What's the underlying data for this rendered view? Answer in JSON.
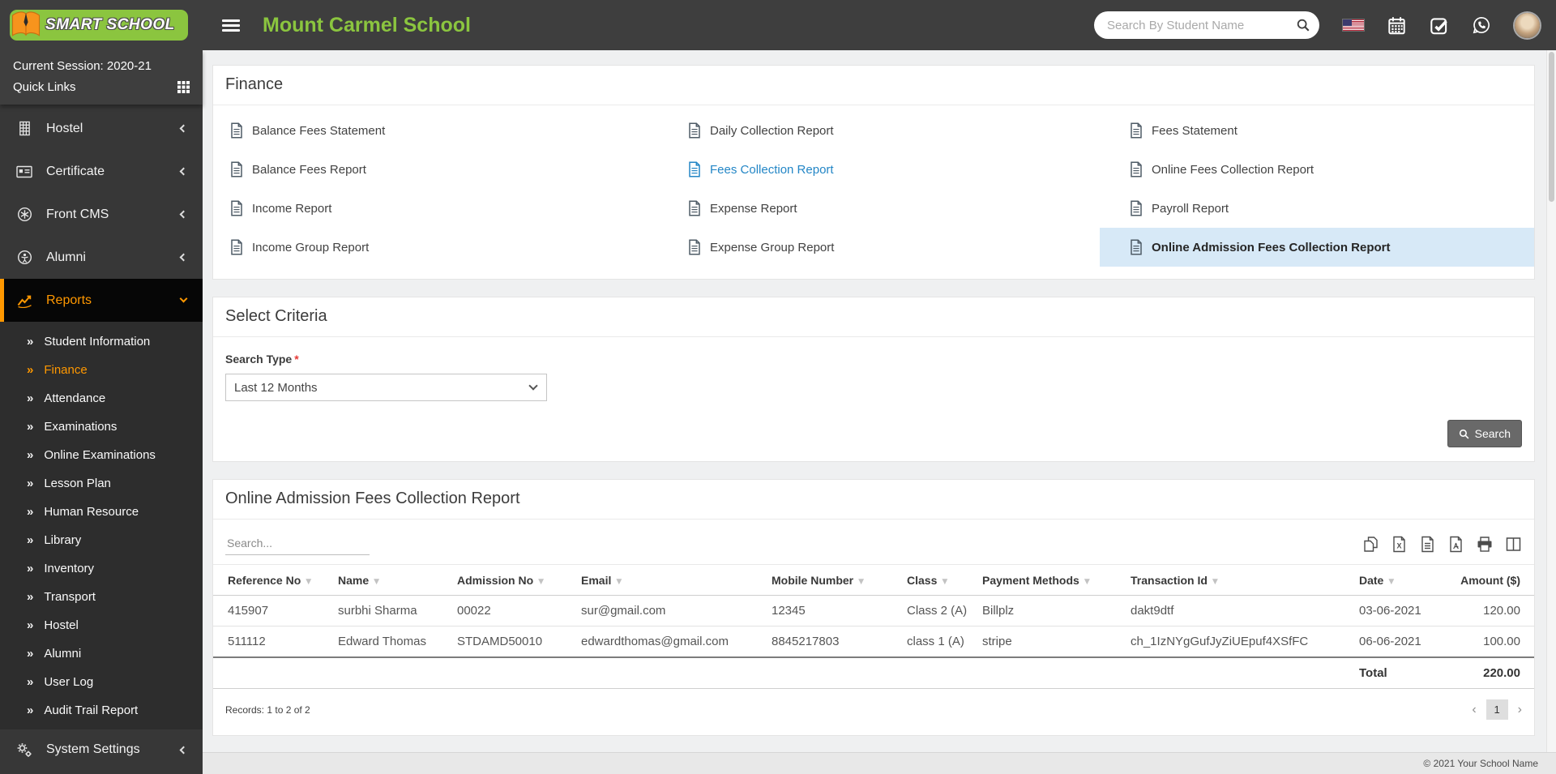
{
  "header": {
    "logo_text": "SMART SCHOOL",
    "school_name": "Mount Carmel School",
    "search_placeholder": "Search By Student Name"
  },
  "sidebar": {
    "session_label": "Current Session: 2020-21",
    "quick_links_label": "Quick Links",
    "items": [
      {
        "label": "Hostel"
      },
      {
        "label": "Certificate"
      },
      {
        "label": "Front CMS"
      },
      {
        "label": "Alumni"
      },
      {
        "label": "Reports"
      }
    ],
    "submenu": [
      "Student Information",
      "Finance",
      "Attendance",
      "Examinations",
      "Online Examinations",
      "Lesson Plan",
      "Human Resource",
      "Library",
      "Inventory",
      "Transport",
      "Hostel",
      "Alumni",
      "User Log",
      "Audit Trail Report"
    ],
    "system_settings_label": "System Settings"
  },
  "finance": {
    "title": "Finance",
    "links": [
      "Balance Fees Statement",
      "Daily Collection Report",
      "Fees Statement",
      "Balance Fees Report",
      "Fees Collection Report",
      "Online Fees Collection Report",
      "Income Report",
      "Expense Report",
      "Payroll Report",
      "Income Group Report",
      "Expense Group Report",
      "Online Admission Fees Collection Report"
    ]
  },
  "criteria": {
    "title": "Select Criteria",
    "search_type_label": "Search Type",
    "required_mark": "*",
    "search_type_value": "Last 12 Months",
    "search_button_label": "Search"
  },
  "report": {
    "title": "Online Admission Fees Collection Report",
    "search_placeholder": "Search...",
    "columns": [
      "Reference No",
      "Name",
      "Admission No",
      "Email",
      "Mobile Number",
      "Class",
      "Payment Methods",
      "Transaction Id",
      "Date",
      "Amount ($)"
    ],
    "rows": [
      [
        "415907",
        "surbhi Sharma",
        "00022",
        "sur@gmail.com",
        "12345",
        "Class 2 (A)",
        "Billplz",
        "dakt9dtf",
        "03-06-2021",
        "120.00"
      ],
      [
        "511112",
        "Edward Thomas",
        "STDAMD50010",
        "edwardthomas@gmail.com",
        "8845217803",
        "class 1 (A)",
        "stripe",
        "ch_1IzNYgGufJyZiUEpuf4XSfFC",
        "06-06-2021",
        "100.00"
      ]
    ],
    "total_label": "Total",
    "total_value": "220.00",
    "records_text": "Records: 1 to 2 of 2",
    "pagination": {
      "prev": "‹",
      "page": "1",
      "next": "›"
    }
  },
  "footer": {
    "copyright": "© 2021 Your School Name"
  },
  "colors": {
    "accent_orange": "#ff9800",
    "brand_green": "#8bc53f",
    "link_blue": "#2386c6",
    "highlight_blue": "#d7e9f7",
    "header_bg": "#3e3e3e"
  }
}
